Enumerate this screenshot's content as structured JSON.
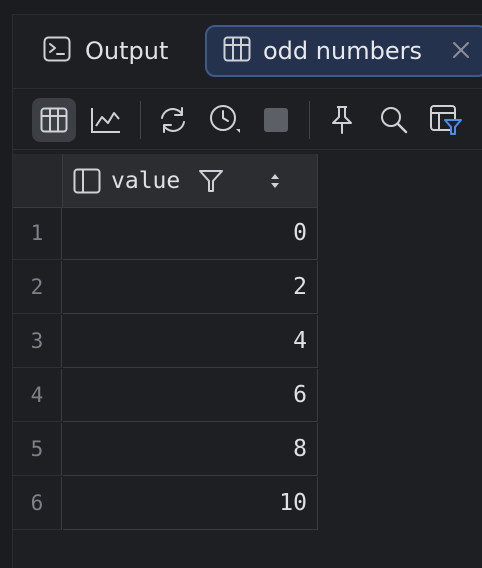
{
  "tabs": {
    "output_label": "Output",
    "active_label": "odd numbers"
  },
  "toolbar": {
    "buttons": [
      "table-view-icon",
      "chart-view-icon",
      "refresh-icon",
      "history-icon",
      "stop-icon",
      "pin-icon",
      "search-icon",
      "filter-table-icon"
    ]
  },
  "grid": {
    "column": "value",
    "rows": [
      {
        "num": "1",
        "value": "0"
      },
      {
        "num": "2",
        "value": "2"
      },
      {
        "num": "3",
        "value": "4"
      },
      {
        "num": "4",
        "value": "6"
      },
      {
        "num": "5",
        "value": "8"
      },
      {
        "num": "6",
        "value": "10"
      }
    ]
  },
  "colors": {
    "background": "#1e1f22",
    "active_tab": "#25324d",
    "active_tab_border": "#3e5a8c",
    "accent_blue": "#4a8fe7"
  }
}
